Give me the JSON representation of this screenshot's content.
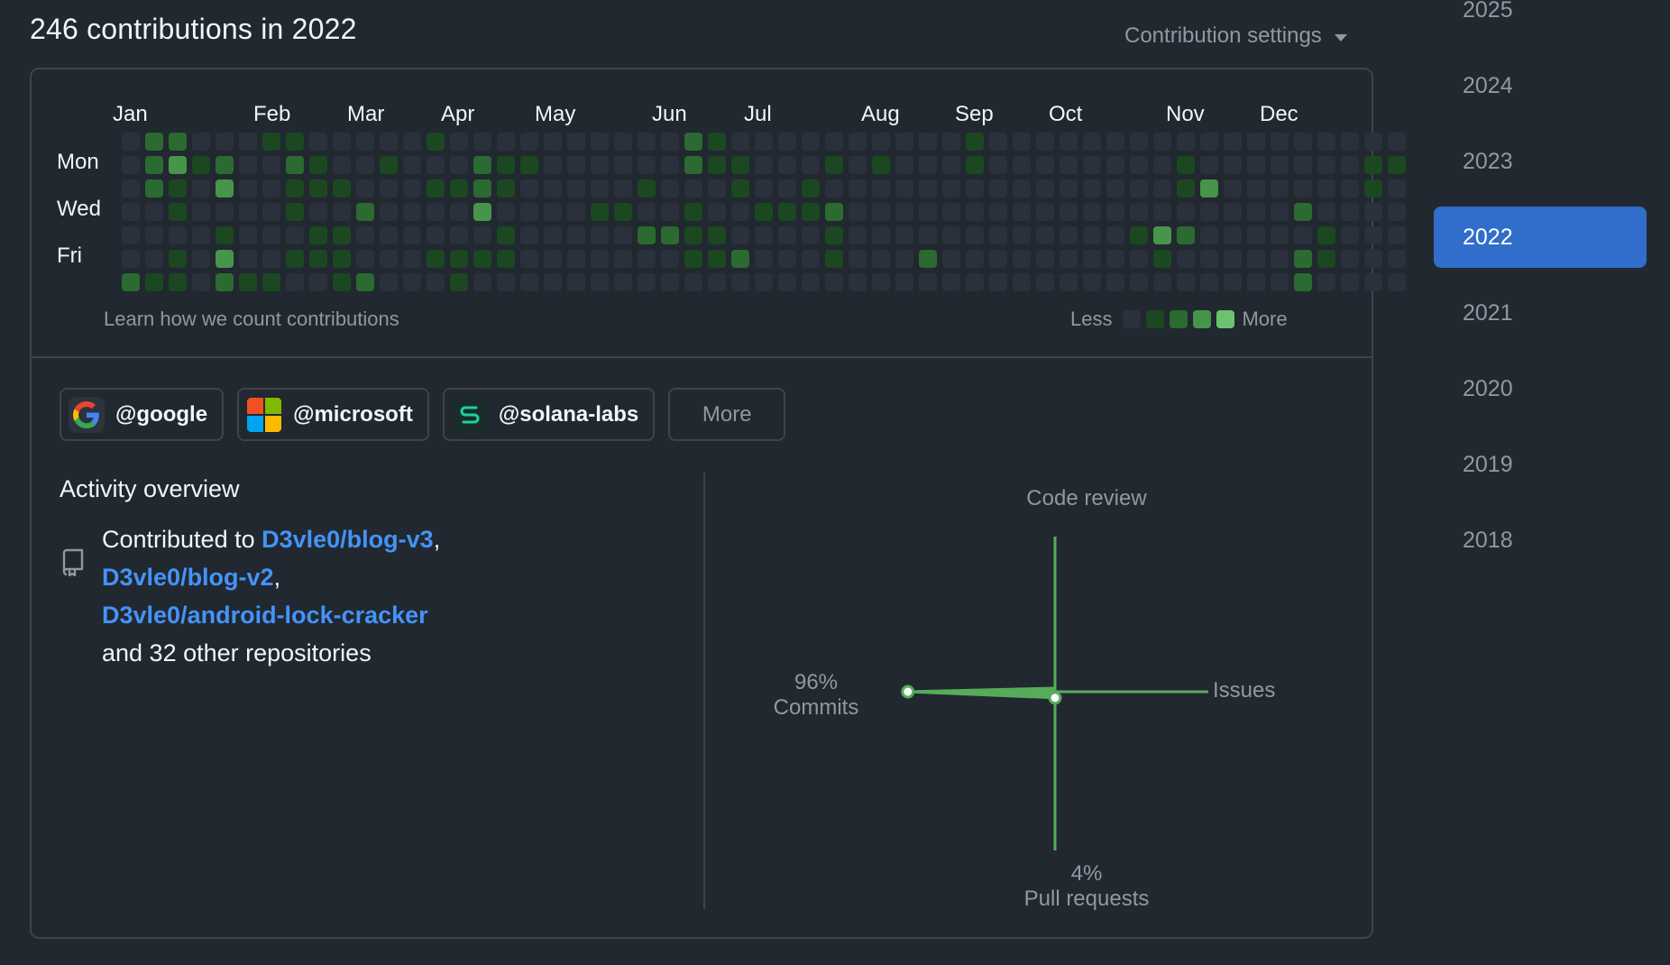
{
  "header": {
    "title": "246 contributions in 2022",
    "settings_label": "Contribution settings"
  },
  "calendar": {
    "months": [
      "Jan",
      "Feb",
      "Mar",
      "Apr",
      "May",
      "Jun",
      "Jul",
      "Aug",
      "Sep",
      "Oct",
      "Nov",
      "Dec"
    ],
    "days": [
      "Mon",
      "Wed",
      "Fri"
    ],
    "learn_label": "Learn how we count contributions",
    "legend_less": "Less",
    "legend_more": "More",
    "level_colors": [
      "#2a313c",
      "#1b4721",
      "#2b6a30",
      "#46954a",
      "#6bc46d"
    ],
    "weeks": [
      [
        0,
        0,
        0,
        0,
        0,
        0,
        2
      ],
      [
        2,
        2,
        2,
        0,
        0,
        0,
        1
      ],
      [
        2,
        3,
        1,
        1,
        0,
        1,
        1
      ],
      [
        0,
        1,
        0,
        0,
        0,
        0,
        0
      ],
      [
        0,
        2,
        3,
        0,
        1,
        3,
        2
      ],
      [
        0,
        0,
        0,
        0,
        0,
        0,
        1
      ],
      [
        1,
        0,
        0,
        0,
        0,
        0,
        1
      ],
      [
        1,
        2,
        1,
        1,
        0,
        1,
        0
      ],
      [
        0,
        1,
        1,
        0,
        1,
        1,
        0
      ],
      [
        0,
        0,
        1,
        0,
        1,
        1,
        1
      ],
      [
        0,
        0,
        0,
        2,
        0,
        0,
        2
      ],
      [
        0,
        1,
        0,
        0,
        0,
        0,
        0
      ],
      [
        0,
        0,
        0,
        0,
        0,
        0,
        0
      ],
      [
        1,
        0,
        1,
        0,
        0,
        1,
        0
      ],
      [
        0,
        0,
        1,
        0,
        0,
        1,
        1
      ],
      [
        0,
        2,
        2,
        3,
        0,
        1,
        0
      ],
      [
        0,
        1,
        1,
        0,
        1,
        1,
        0
      ],
      [
        0,
        1,
        0,
        0,
        0,
        0,
        0
      ],
      [
        0,
        0,
        0,
        0,
        0,
        0,
        0
      ],
      [
        0,
        0,
        0,
        0,
        0,
        0,
        0
      ],
      [
        0,
        0,
        0,
        1,
        0,
        0,
        0
      ],
      [
        0,
        0,
        0,
        1,
        0,
        0,
        0
      ],
      [
        0,
        0,
        1,
        0,
        2,
        0,
        0
      ],
      [
        0,
        0,
        0,
        0,
        2,
        0,
        0
      ],
      [
        2,
        2,
        0,
        1,
        1,
        1,
        0
      ],
      [
        1,
        1,
        0,
        0,
        1,
        1,
        0
      ],
      [
        0,
        1,
        1,
        0,
        0,
        2,
        0
      ],
      [
        0,
        0,
        0,
        1,
        0,
        0,
        0
      ],
      [
        0,
        0,
        0,
        1,
        0,
        0,
        0
      ],
      [
        0,
        0,
        1,
        1,
        0,
        0,
        0
      ],
      [
        0,
        1,
        0,
        2,
        1,
        1,
        0
      ],
      [
        0,
        0,
        0,
        0,
        0,
        0,
        0
      ],
      [
        0,
        1,
        0,
        0,
        0,
        0,
        0
      ],
      [
        0,
        0,
        0,
        0,
        0,
        0,
        0
      ],
      [
        0,
        0,
        0,
        0,
        0,
        2,
        0
      ],
      [
        0,
        0,
        0,
        0,
        0,
        0,
        0
      ],
      [
        1,
        1,
        0,
        0,
        0,
        0,
        0
      ],
      [
        0,
        0,
        0,
        0,
        0,
        0,
        0
      ],
      [
        0,
        0,
        0,
        0,
        0,
        0,
        0
      ],
      [
        0,
        0,
        0,
        0,
        0,
        0,
        0
      ],
      [
        0,
        0,
        0,
        0,
        0,
        0,
        0
      ],
      [
        0,
        0,
        0,
        0,
        0,
        0,
        0
      ],
      [
        0,
        0,
        0,
        0,
        0,
        0,
        0
      ],
      [
        0,
        0,
        0,
        0,
        1,
        0,
        0
      ],
      [
        0,
        0,
        0,
        0,
        3,
        1,
        0
      ],
      [
        0,
        1,
        1,
        0,
        2,
        0,
        0
      ],
      [
        0,
        0,
        3,
        0,
        0,
        0,
        0
      ],
      [
        0,
        0,
        0,
        0,
        0,
        0,
        0
      ],
      [
        0,
        0,
        0,
        0,
        0,
        0,
        0
      ],
      [
        0,
        0,
        0,
        0,
        0,
        0,
        0
      ],
      [
        0,
        0,
        0,
        2,
        0,
        2,
        2
      ],
      [
        0,
        0,
        0,
        0,
        1,
        1,
        0
      ],
      [
        0,
        0,
        0,
        0,
        0,
        0,
        0
      ],
      [
        0,
        1,
        1,
        0,
        0,
        0,
        0
      ],
      [
        0,
        1,
        0,
        0,
        0,
        0,
        0
      ]
    ]
  },
  "orgs": [
    {
      "label": "@google",
      "icon": "google-logo-icon"
    },
    {
      "label": "@microsoft",
      "icon": "microsoft-logo-icon"
    },
    {
      "label": "@solana-labs",
      "icon": "solana-logo-icon"
    }
  ],
  "orgs_more_label": "More",
  "activity": {
    "title": "Activity overview",
    "contributed_prefix": "Contributed to ",
    "repos": [
      "D3vle0/blog-v3",
      "D3vle0/blog-v2",
      "D3vle0/android-lock-cracker"
    ],
    "separator": ",",
    "suffix": "and 32 other repositories"
  },
  "radar": {
    "code_review_label": "Code review",
    "issues_label": "Issues",
    "commits_pct": "96%",
    "commits_label": "Commits",
    "pr_pct": "4%",
    "pr_label": "Pull requests",
    "commits_value": 96,
    "pull_requests_value": 4,
    "color": "#57ab5a"
  },
  "years": [
    "2025",
    "2024",
    "2023",
    "2022",
    "2021",
    "2020",
    "2019",
    "2018"
  ],
  "active_year": "2022"
}
